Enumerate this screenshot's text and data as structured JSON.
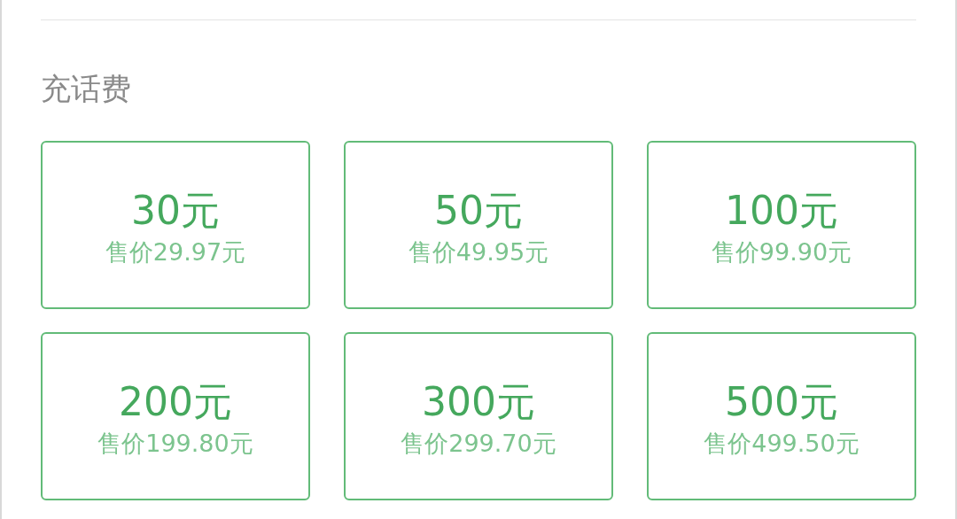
{
  "section": {
    "title": "充话费"
  },
  "options": [
    {
      "amount": "30元",
      "price": "售价29.97元"
    },
    {
      "amount": "50元",
      "price": "售价49.95元"
    },
    {
      "amount": "100元",
      "price": "售价99.90元"
    },
    {
      "amount": "200元",
      "price": "售价199.80元"
    },
    {
      "amount": "300元",
      "price": "售价299.70元"
    },
    {
      "amount": "500元",
      "price": "售价499.50元"
    }
  ]
}
